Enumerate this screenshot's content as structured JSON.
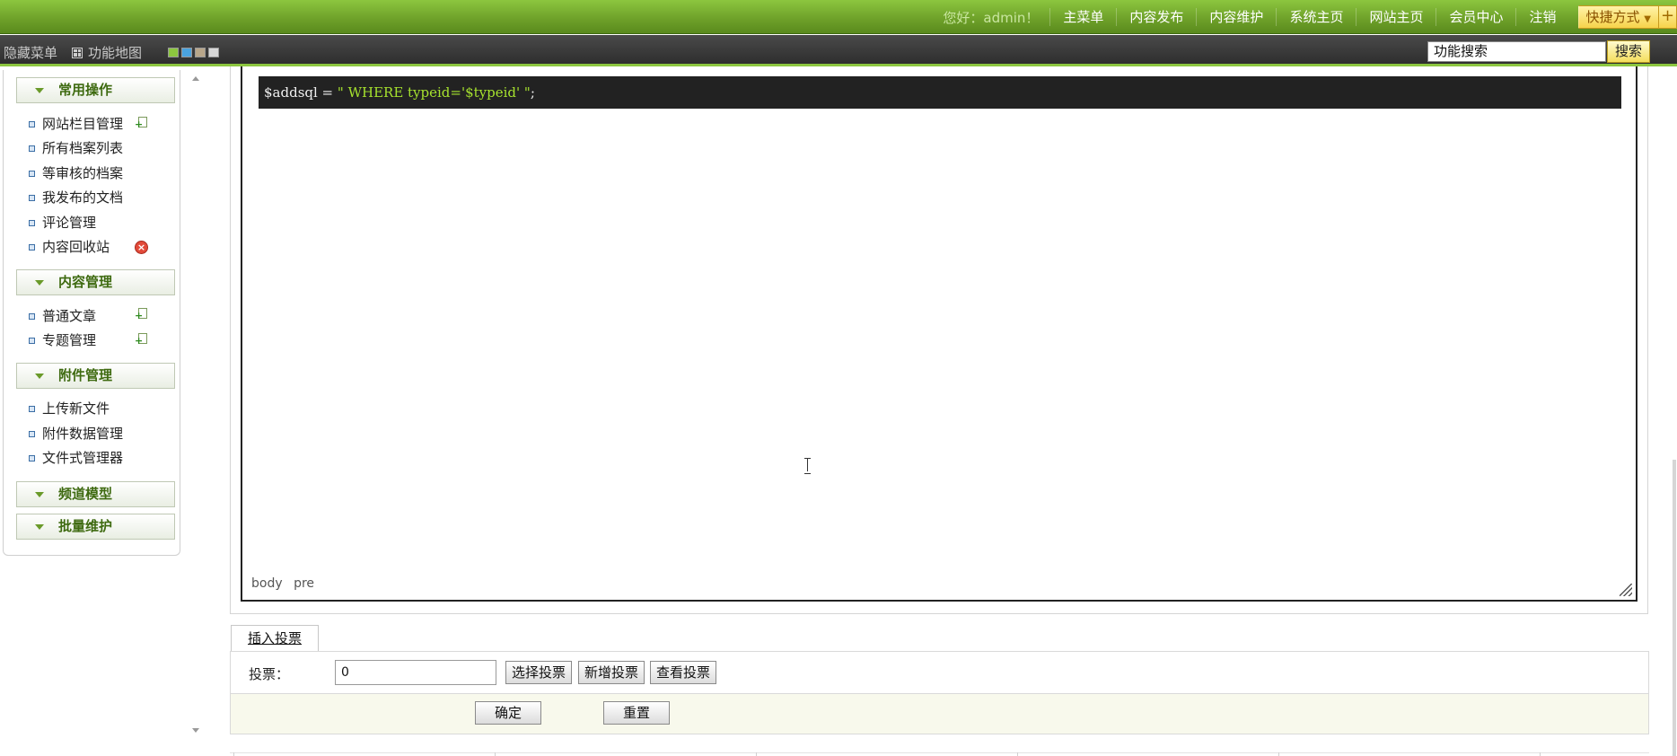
{
  "header": {
    "greeting": "您好：admin！",
    "nav": [
      "主菜单",
      "内容发布",
      "内容维护",
      "系统主页",
      "网站主页",
      "会员中心",
      "注销"
    ],
    "quick_label": "快捷方式"
  },
  "toolbar": {
    "hide_menu": "隐藏菜单",
    "function_map": "功能地图",
    "swatch_colors": [
      "#8cc63f",
      "#4aa3df",
      "#b8a68a",
      "#d8d8d8"
    ],
    "search_value": "功能搜索",
    "search_button": "搜索"
  },
  "sidebar": {
    "sections": [
      {
        "title": "常用操作",
        "items": [
          "网站栏目管理",
          "所有档案列表",
          "等审核的档案",
          "我发布的文档",
          "评论管理",
          "内容回收站"
        ]
      },
      {
        "title": "内容管理",
        "items": [
          "普通文章",
          "专题管理"
        ]
      },
      {
        "title": "附件管理",
        "items": [
          "上传新文件",
          "附件数据管理",
          "文件式管理器"
        ]
      },
      {
        "title": "频道模型",
        "items": []
      },
      {
        "title": "批量维护",
        "items": []
      }
    ]
  },
  "editor": {
    "code_prefix": "$addsql = ",
    "code_string": "\" WHERE typeid='$typeid' \"",
    "code_suffix": ";",
    "path": [
      "body",
      "pre"
    ]
  },
  "vote": {
    "tab_label": "插入投票",
    "label": "投票：",
    "value": "0",
    "select_btn": "选择投票",
    "new_btn": "新增投票",
    "view_btn": "查看投票"
  },
  "actions": {
    "ok": "确定",
    "reset": "重置"
  },
  "colors": {
    "brand_green": "#8cc63f",
    "code_bg": "#222222",
    "code_string": "#a6e22e"
  }
}
